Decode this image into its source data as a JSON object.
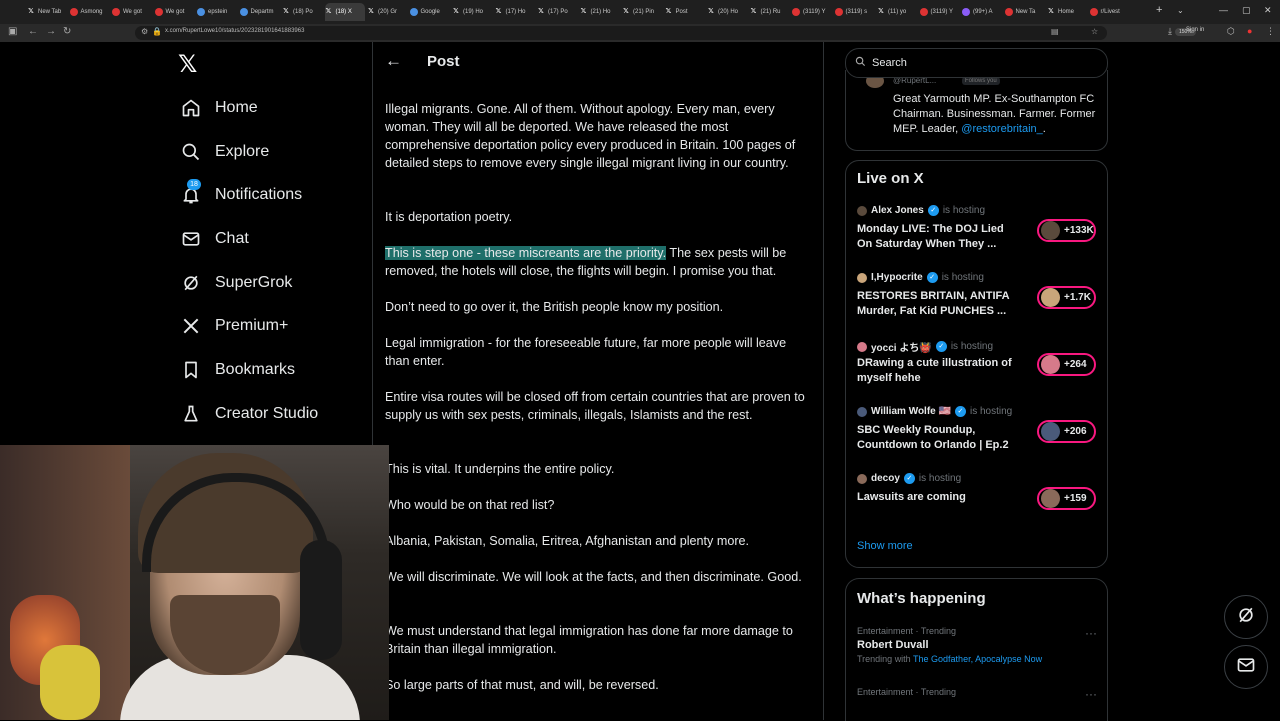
{
  "browser": {
    "tabs": [
      {
        "label": "New Tab",
        "icon": "x",
        "active": false
      },
      {
        "label": "Asmong",
        "icon": "red",
        "active": false
      },
      {
        "label": "We got",
        "icon": "red",
        "active": false
      },
      {
        "label": "We got",
        "icon": "red",
        "active": false
      },
      {
        "label": "epstein",
        "icon": "g",
        "active": false
      },
      {
        "label": "Departm",
        "icon": "g",
        "active": false
      },
      {
        "label": "(18) Po",
        "icon": "x",
        "active": false
      },
      {
        "label": "(18) X",
        "icon": "x",
        "active": true
      },
      {
        "label": "(20) Gr",
        "icon": "x",
        "active": false
      },
      {
        "label": "Google",
        "icon": "g",
        "active": false
      },
      {
        "label": "(19) Ho",
        "icon": "x",
        "active": false
      },
      {
        "label": "(17) Ho",
        "icon": "x",
        "active": false
      },
      {
        "label": "(17) Po",
        "icon": "x",
        "active": false
      },
      {
        "label": "(21) Ho",
        "icon": "x",
        "active": false
      },
      {
        "label": "(21) Pin",
        "icon": "x",
        "active": false
      },
      {
        "label": "Post",
        "icon": "x",
        "active": false
      },
      {
        "label": "(20) Ho",
        "icon": "x",
        "active": false
      },
      {
        "label": "(21) Ru",
        "icon": "x",
        "active": false
      },
      {
        "label": "(3119) Y",
        "icon": "red",
        "active": false
      },
      {
        "label": "(3119) s",
        "icon": "red",
        "active": false
      },
      {
        "label": "(11) yo",
        "icon": "x",
        "active": false
      },
      {
        "label": "(3119) Y",
        "icon": "red",
        "active": false
      },
      {
        "label": "(99+) A",
        "icon": "p",
        "active": false
      },
      {
        "label": "New Ta",
        "icon": "red",
        "active": false
      },
      {
        "label": "Home",
        "icon": "x",
        "active": false
      },
      {
        "label": "r/Livest",
        "icon": "red",
        "active": false
      }
    ],
    "url": "x.com/RupertLowe10/status/2023281901641883963",
    "zoom": "150%",
    "signin": "Sign in"
  },
  "nav": {
    "items": [
      {
        "key": "home",
        "label": "Home"
      },
      {
        "key": "explore",
        "label": "Explore"
      },
      {
        "key": "notifications",
        "label": "Notifications",
        "badge": "18"
      },
      {
        "key": "chat",
        "label": "Chat"
      },
      {
        "key": "supergrok",
        "label": "SuperGrok"
      },
      {
        "key": "premium",
        "label": "Premium+"
      },
      {
        "key": "bookmarks",
        "label": "Bookmarks"
      },
      {
        "key": "creator",
        "label": "Creator Studio"
      }
    ]
  },
  "post": {
    "header_title": "Post",
    "p1": "Illegal migrants. Gone. All of them. Without apology. Every man, every woman. They will all be deported. We have released the most comprehensive deportation policy every produced in Britain. 100 pages of detailed steps to remove every single illegal migrant living in our country.",
    "p2": "It is deportation poetry.",
    "p3_highlight": "This is step one - these miscreants are the priority.",
    "p3_rest": " The sex pests will be removed, the hotels will close, the flights will begin. I promise you that.",
    "p4": "Don’t need to go over it, the British people know my position.",
    "p5": "Legal immigration - for the foreseeable future, far more people will leave than enter.",
    "p6": "Entire visa routes will be closed off from certain countries that are proven to supply us with sex pests, criminals, illegals, Islamists and the rest.",
    "p7": "This is vital. It underpins the entire policy.",
    "p8": "Who would be on that red list?",
    "p9": "Albania, Pakistan, Somalia, Eritrea, Afghanistan and plenty more.",
    "p10": "We will discriminate. We will look at the facts, and then discriminate. Good.",
    "p11": "We must understand that legal immigration has done far more damage to Britain than illegal immigration.",
    "p12": "So large parts of that must, and will, be reversed."
  },
  "right": {
    "search_placeholder": "Search",
    "profile": {
      "handle_partial": "@RupertL...",
      "follows_you": "Follows you",
      "bio_text": "Great Yarmouth MP. Ex-Southampton FC Chairman. Businessman. Farmer. Former MEP. Leader, ",
      "bio_link": "@restorebritain_",
      "bio_end": "."
    },
    "live": {
      "title": "Live on X",
      "hosting_text": "is hosting",
      "items": [
        {
          "host": "Alex Jones",
          "verified": true,
          "title": "Monday LIVE: The DOJ Lied On Saturday When They ...",
          "count": "+133K",
          "av": "#5a4a3c"
        },
        {
          "host": "I,Hypocrite",
          "verified": true,
          "title": "RESTORES BRITAIN, ANTIFA Murder, Fat Kid PUNCHES ...",
          "count": "+1.7K",
          "av": "#c9a57a"
        },
        {
          "host": "yocci よち👹",
          "verified": true,
          "title": "DRawing a cute illustration of myself hehe",
          "count": "+264",
          "av": "#d67a8a"
        },
        {
          "host": "William Wolfe 🇺🇸",
          "verified": true,
          "title": "SBC Weekly Roundup, Countdown to Orlando | Ep.2",
          "count": "+206",
          "av": "#4a5a7a"
        },
        {
          "host": "decoy",
          "verified": true,
          "title": "Lawsuits are coming",
          "count": "+159",
          "av": "#8a6a5a"
        }
      ],
      "show_more": "Show more"
    },
    "happening": {
      "title": "What’s happening",
      "trends": [
        {
          "meta": "Entertainment · Trending",
          "name": "Robert Duvall",
          "with_label": "Trending with ",
          "with_links": "The Godfather, Apocalypse Now"
        },
        {
          "meta": "Entertainment · Trending",
          "name": "",
          "with_label": "",
          "with_links": ""
        }
      ]
    }
  },
  "colors": {
    "accent": "#1d9bf0",
    "highlight": "#1f6f6a",
    "live_pill": "#f91880",
    "border": "#2f3336"
  }
}
